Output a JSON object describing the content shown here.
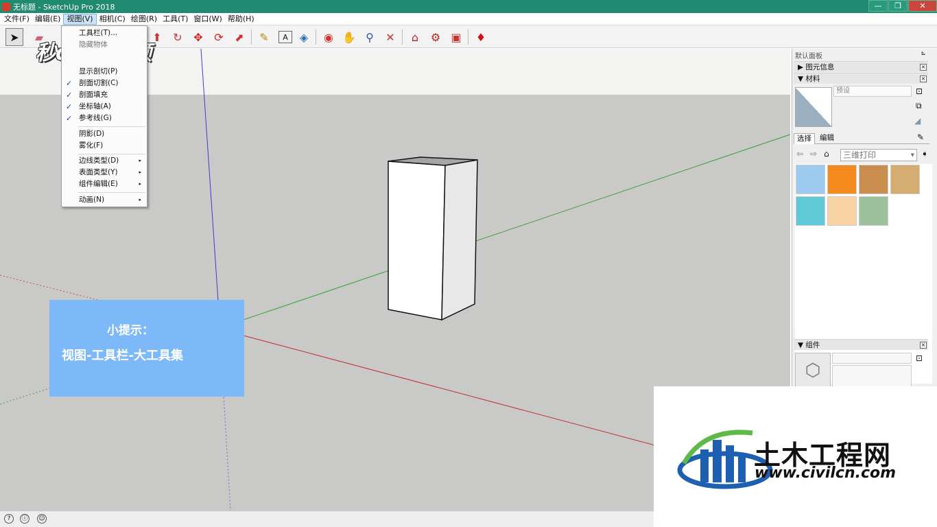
{
  "window": {
    "title": "无标题 - SketchUp Pro 2018",
    "controls": [
      "—",
      "❐",
      "✕"
    ]
  },
  "menubar": [
    "文件(F)",
    "编辑(E)",
    "视图(V)",
    "相机(C)",
    "绘图(R)",
    "工具(T)",
    "窗口(W)",
    "帮助(H)"
  ],
  "view_menu": {
    "items": [
      {
        "label": "工具栏(T)...",
        "checked": false
      },
      {
        "label": "隐藏物体",
        "checked": false
      },
      {
        "label": "显示剖切(P)",
        "checked": false
      },
      {
        "label": "剖面切割(C)",
        "checked": true
      },
      {
        "label": "剖面填充",
        "checked": true
      },
      {
        "label": "坐标轴(A)",
        "checked": true
      },
      {
        "label": "参考线(G)",
        "checked": true
      },
      {
        "label": "阴影(D)",
        "checked": false
      },
      {
        "label": "雾化(F)",
        "checked": false
      },
      {
        "label": "边线类型(D)",
        "submenu": true
      },
      {
        "label": "表面类型(Y)",
        "submenu": true
      },
      {
        "label": "组件编辑(E)",
        "submenu": true
      },
      {
        "label": "动画(N)",
        "submenu": true
      }
    ],
    "check_glyph": "✓",
    "arrow_glyph": "▸"
  },
  "toolbar": {
    "icons": [
      {
        "name": "select-icon",
        "glyph": "➤"
      },
      {
        "name": "eraser-icon",
        "glyph": "▰"
      },
      {
        "name": "push-pull-icon",
        "glyph": "⬆"
      },
      {
        "name": "follow-me-icon",
        "glyph": "↻"
      },
      {
        "name": "move-icon",
        "glyph": "✥"
      },
      {
        "name": "rotate-icon",
        "glyph": "⟳"
      },
      {
        "name": "scale-icon",
        "glyph": "⬈"
      },
      {
        "name": "tape-measure-icon",
        "glyph": "✎"
      },
      {
        "name": "text-icon",
        "glyph": "A"
      },
      {
        "name": "paint-bucket-icon",
        "glyph": "◈"
      },
      {
        "name": "orbit-icon",
        "glyph": "◉"
      },
      {
        "name": "pan-icon",
        "glyph": "✋"
      },
      {
        "name": "zoom-icon",
        "glyph": "⚲"
      },
      {
        "name": "zoom-extents-icon",
        "glyph": "✕"
      },
      {
        "name": "warehouse-icon",
        "glyph": "⌂"
      },
      {
        "name": "extension-warehouse-icon",
        "glyph": "⚙"
      },
      {
        "name": "layout-icon",
        "glyph": "▣"
      },
      {
        "name": "ruby-icon",
        "glyph": "♦"
      }
    ]
  },
  "watermark": "秒dong视频",
  "tip": {
    "line1": "小提示：",
    "line2": "视图-工具栏-大工具集"
  },
  "panel": {
    "title": "默认面板",
    "pin_glyph": "⊾",
    "entity_info": "▶ 图元信息",
    "materials": "▼ 材料",
    "preset_placeholder": "预设",
    "tabs": [
      "选择",
      "编辑"
    ],
    "library": "三维打印",
    "nav": [
      "⇦",
      "⇨",
      "⌂"
    ],
    "swatch_colors": [
      "#9ccbef",
      "#f28a1c",
      "#c98d4e",
      "#d5ad72",
      "#5fc9d8",
      "#f8d3a4",
      "#9cc19a"
    ],
    "components": "▼ 组件",
    "close_glyph": "×"
  },
  "brand": {
    "cn": "土木工程网",
    "url": "www.civilcn.com"
  },
  "status": {
    "icons": [
      "?",
      "ⓘ",
      "☺"
    ]
  }
}
